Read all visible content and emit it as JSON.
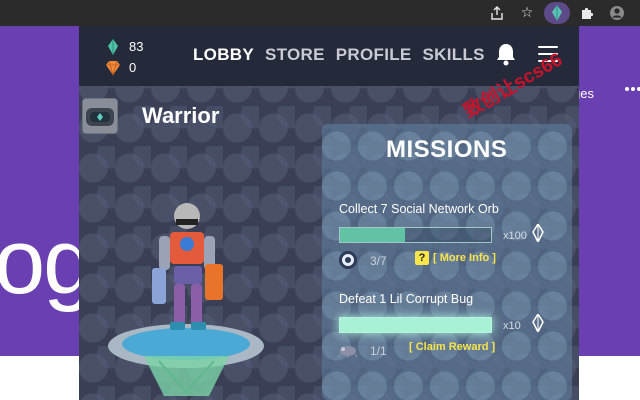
{
  "browser": {
    "icons": [
      "share-icon",
      "bookmark-star-icon",
      "extension-active-icon",
      "puzzle-icon",
      "profile-icon"
    ]
  },
  "background_page": {
    "logo_fragment": "ogl",
    "right_text": "ges"
  },
  "popup": {
    "currency": {
      "gems": "83",
      "crystals": "0"
    },
    "nav": {
      "lobby": "LOBBY",
      "store": "STORE",
      "profile": "PROFILE",
      "skills": "SKILLS"
    },
    "character": {
      "name": "Warrior"
    },
    "missions": {
      "title": "MISSIONS",
      "items": [
        {
          "title": "Collect 7 Social Network Orb",
          "progress": "3/7",
          "progress_fraction": 0.43,
          "reward": "x100",
          "help": "?",
          "link": "[ More Info ]"
        },
        {
          "title": "Defeat 1 Lil Corrupt Bug",
          "progress": "1/1",
          "progress_fraction": 1.0,
          "reward": "x10",
          "link": "[ Claim Reward ]"
        }
      ]
    },
    "watermark": "致创让scs66"
  },
  "colors": {
    "accent_yellow": "#f7e54a",
    "bar_fill": "#62c2a6",
    "topbar": "#252a3b",
    "page_purple": "#6a3fb1"
  }
}
